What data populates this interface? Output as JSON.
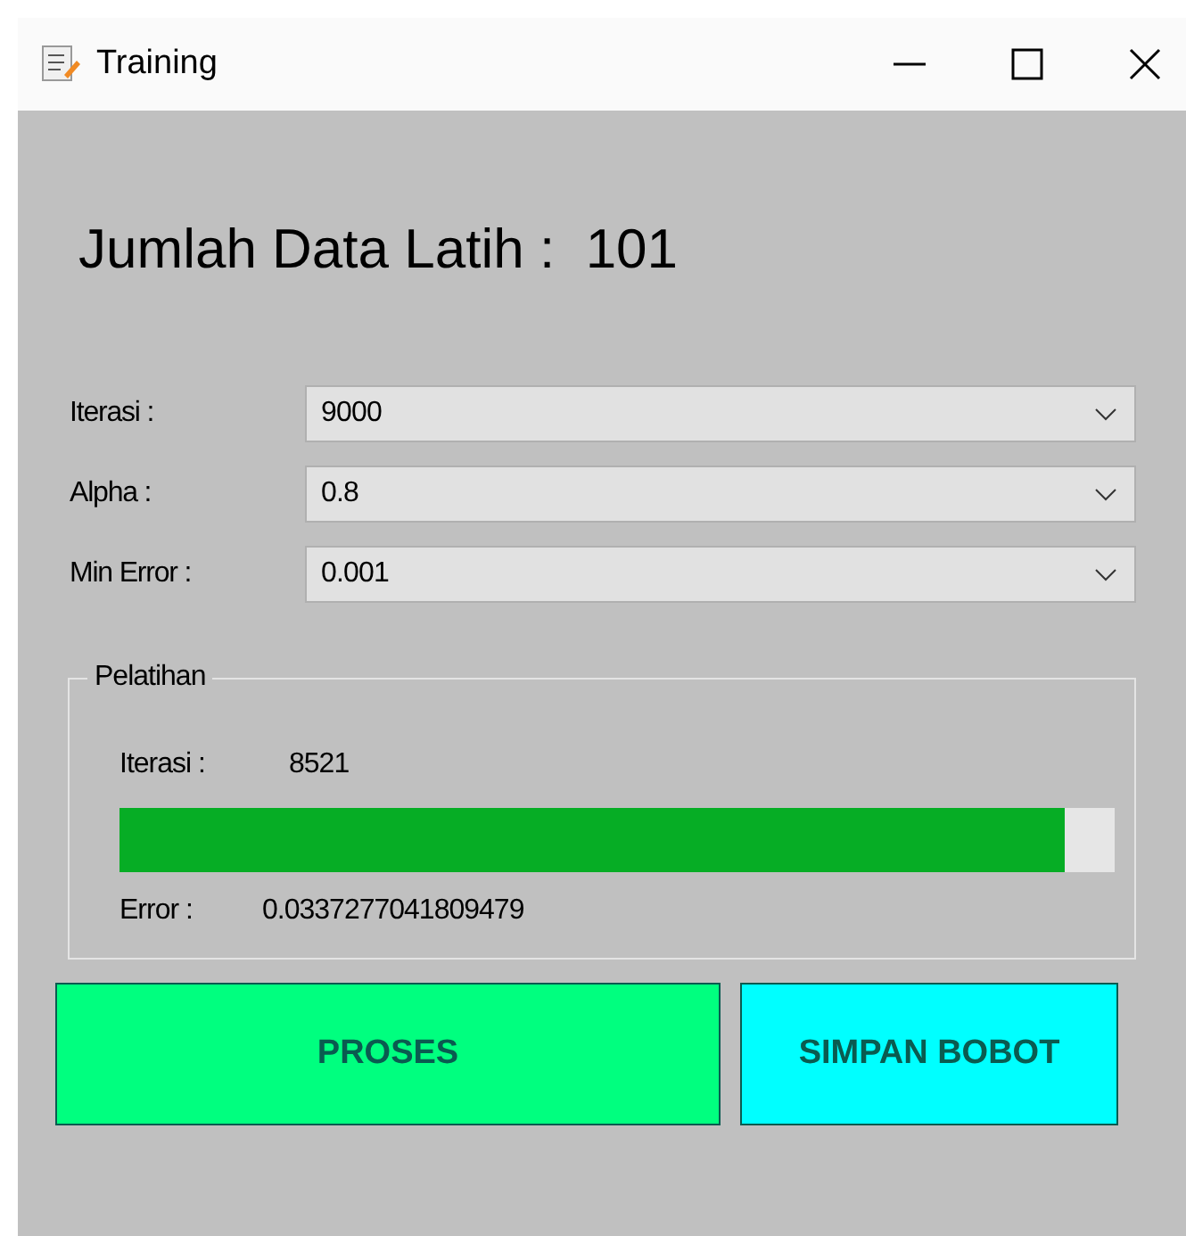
{
  "window": {
    "title": "Training"
  },
  "heading": "Jumlah Data Latih :  101",
  "settings": [
    {
      "label": "Iterasi :",
      "value": "9000"
    },
    {
      "label": "Alpha :",
      "value": "0.8"
    },
    {
      "label": "Min Error :",
      "value": "0.001"
    }
  ],
  "training_group": {
    "title": "Pelatihan",
    "iteration_label": "Iterasi :",
    "iteration_value": "8521",
    "progress": {
      "level": 0.95
    },
    "error_label": "Error :",
    "error_value": "0.0337277041809479"
  },
  "buttons": [
    {
      "label": "PROSES",
      "color": "#00ff7f"
    },
    {
      "label": "SIMPAN BOBOT",
      "color": "#00ffff"
    }
  ]
}
